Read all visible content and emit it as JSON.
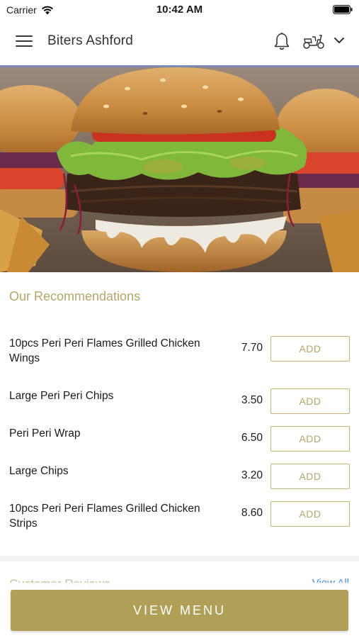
{
  "status_bar": {
    "carrier": "Carrier",
    "time": "10:42 AM"
  },
  "header": {
    "title": "Biters Ashford",
    "icons": [
      "hamburger-menu-icon",
      "bell-icon",
      "scooter-icon",
      "chevron-down-icon"
    ]
  },
  "hero": {
    "image": "burger-photo"
  },
  "recommendations": {
    "title": "Our Recommendations",
    "items": [
      {
        "name": "10pcs Peri Peri Flames Grilled Chicken Wings",
        "price": "7.70",
        "button": "ADD"
      },
      {
        "name": "Large Peri Peri Chips",
        "price": "3.50",
        "button": "ADD"
      },
      {
        "name": "Peri Peri Wrap",
        "price": "6.50",
        "button": "ADD"
      },
      {
        "name": "Large Chips",
        "price": "3.20",
        "button": "ADD"
      },
      {
        "name": "10pcs Peri Peri Flames Grilled Chicken Strips",
        "price": "8.60",
        "button": "ADD"
      }
    ]
  },
  "reviews": {
    "title": "Customer Reviews",
    "view_all": "View All"
  },
  "footer": {
    "view_menu_label": "VIEW MENU"
  },
  "colors": {
    "accent": "#b09f57",
    "accent_text": "#b3a56b",
    "header_line": "#7a8bb8"
  }
}
